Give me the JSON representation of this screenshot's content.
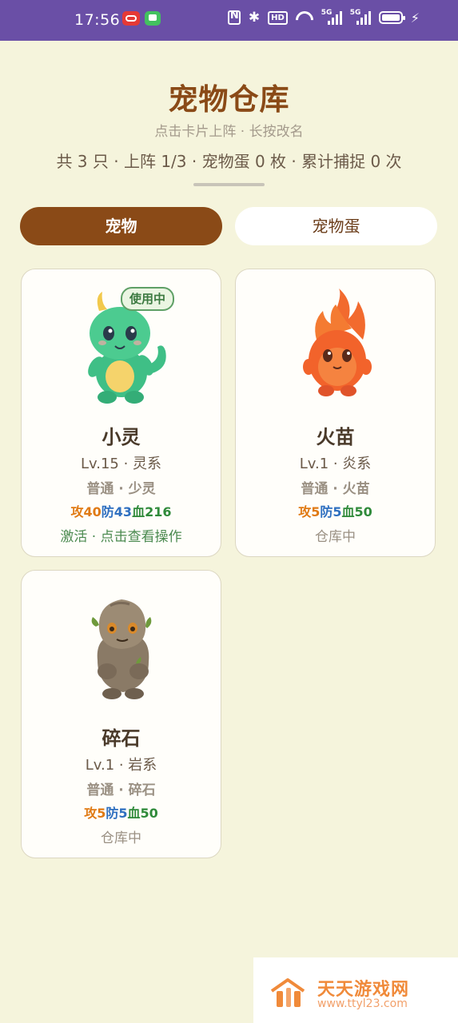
{
  "status_bar": {
    "time": "17:56",
    "icons": [
      "nfc-icon",
      "bluetooth-icon",
      "hd-icon",
      "wifi-icon",
      "signal-5g-icon",
      "signal-5g-icon",
      "battery-icon",
      "charging-icon"
    ],
    "sig1_label": "5G",
    "sig2_label": "5G",
    "hd_label": "HD",
    "bg_color": "#6a4fa6"
  },
  "header": {
    "title": "宠物仓库",
    "subtitle": "点击卡片上阵 · 长按改名",
    "stats": "共 3 只 · 上阵 1/3 · 宠物蛋 0 枚 · 累计捕捉 0 次"
  },
  "tabs": [
    {
      "label": "宠物",
      "active": true
    },
    {
      "label": "宠物蛋",
      "active": false
    }
  ],
  "pets": [
    {
      "name": "小灵",
      "level": "Lv.15 · 灵系",
      "type": "普通 · 少灵",
      "atk_label": "攻40",
      "def_label": "防43",
      "hp_label": "血216",
      "status": "激活 · 点击查看操作",
      "badge": "使用中",
      "icon": "green-dragon-icon"
    },
    {
      "name": "火苗",
      "level": "Lv.1 · 炎系",
      "type": "普通 · 火苗",
      "atk_label": "攻5",
      "def_label": "防5",
      "hp_label": "血50",
      "status": "仓库中",
      "icon": "fire-sprite-icon"
    },
    {
      "name": "碎石",
      "level": "Lv.1 · 岩系",
      "type": "普通 · 碎石",
      "atk_label": "攻5",
      "def_label": "防5",
      "hp_label": "血50",
      "status": "仓库中",
      "icon": "rock-golem-icon"
    }
  ],
  "colors": {
    "background": "#f5f4dc",
    "title": "#8a4a17",
    "active_tab": "#8a4a17",
    "atk": "#e07a14",
    "def": "#2e6fc0",
    "hp": "#2f8a3a",
    "badge": "#5fa066"
  },
  "watermark": {
    "name": "天天游戏网",
    "url": "www.ttyl23.com",
    "icon": "ttyl-logo-icon"
  }
}
